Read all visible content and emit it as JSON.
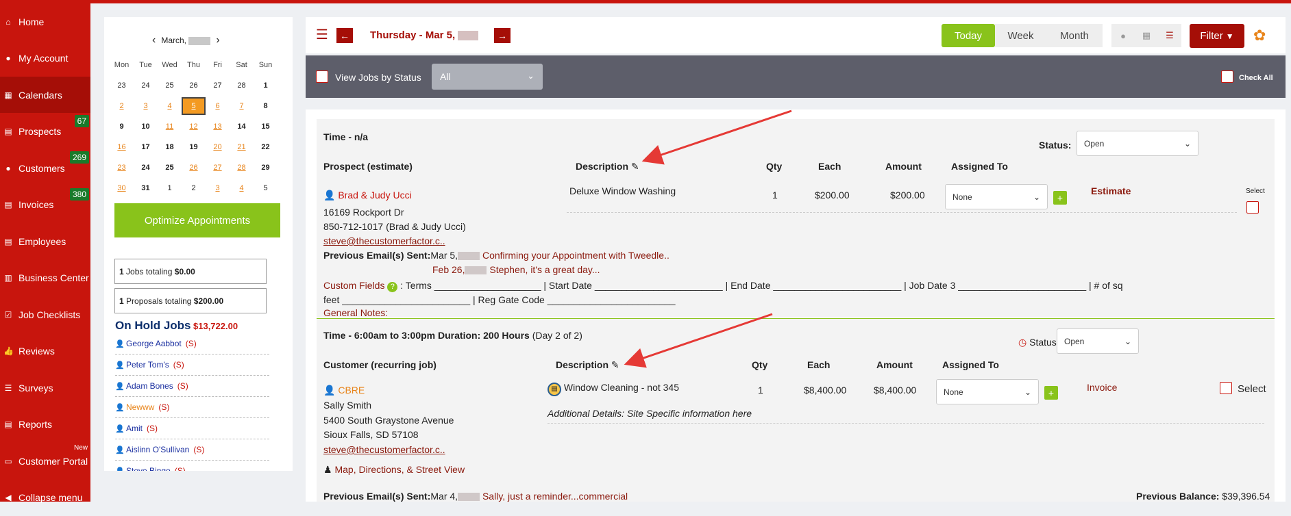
{
  "sidebar": {
    "items": [
      {
        "label": "Home",
        "icon": "home-icon",
        "glyph": "⌂"
      },
      {
        "label": "My Account",
        "icon": "user-circle-icon",
        "glyph": "●"
      },
      {
        "label": "Calendars",
        "icon": "calendar-icon",
        "glyph": "▦"
      },
      {
        "label": "Prospects",
        "icon": "document-icon",
        "glyph": "▤",
        "badge": "67"
      },
      {
        "label": "Customers",
        "icon": "users-icon",
        "glyph": "●",
        "badge": "269"
      },
      {
        "label": "Invoices",
        "icon": "invoice-icon",
        "glyph": "▤",
        "badge": "380"
      },
      {
        "label": "Employees",
        "icon": "employee-icon",
        "glyph": "▤"
      },
      {
        "label": "Business Center",
        "icon": "building-icon",
        "glyph": "▥"
      },
      {
        "label": "Job Checklists",
        "icon": "checkbox-icon",
        "glyph": "☑"
      },
      {
        "label": "Reviews",
        "icon": "thumbs-up-icon",
        "glyph": "👍"
      },
      {
        "label": "Surveys",
        "icon": "list-icon",
        "glyph": "☰"
      },
      {
        "label": "Reports",
        "icon": "report-icon",
        "glyph": "▤"
      },
      {
        "label": "Customer Portal",
        "icon": "laptop-icon",
        "glyph": "▭",
        "new_badge": "New"
      },
      {
        "label": "Collapse menu",
        "icon": "collapse-icon",
        "glyph": "◀"
      }
    ]
  },
  "calendar": {
    "month_label": "March,",
    "prev": "‹",
    "next": "›",
    "weekdays": [
      "Mon",
      "Tue",
      "Wed",
      "Thu",
      "Fri",
      "Sat",
      "Sun"
    ],
    "weeks": [
      [
        {
          "d": "23"
        },
        {
          "d": "24"
        },
        {
          "d": "25"
        },
        {
          "d": "26"
        },
        {
          "d": "27"
        },
        {
          "d": "28"
        },
        {
          "d": "1",
          "s": "bd"
        }
      ],
      [
        {
          "d": "2",
          "s": "ln"
        },
        {
          "d": "3",
          "s": "ln"
        },
        {
          "d": "4",
          "s": "ln"
        },
        {
          "d": "5",
          "s": "today"
        },
        {
          "d": "6",
          "s": "ln"
        },
        {
          "d": "7",
          "s": "ln"
        },
        {
          "d": "8",
          "s": "bd"
        }
      ],
      [
        {
          "d": "9",
          "s": "bd"
        },
        {
          "d": "10",
          "s": "bd"
        },
        {
          "d": "11",
          "s": "ln"
        },
        {
          "d": "12",
          "s": "ln"
        },
        {
          "d": "13",
          "s": "ln"
        },
        {
          "d": "14",
          "s": "bd"
        },
        {
          "d": "15",
          "s": "bd"
        }
      ],
      [
        {
          "d": "16",
          "s": "ln"
        },
        {
          "d": "17",
          "s": "bd"
        },
        {
          "d": "18",
          "s": "bd"
        },
        {
          "d": "19",
          "s": "bd"
        },
        {
          "d": "20",
          "s": "ln"
        },
        {
          "d": "21",
          "s": "ln"
        },
        {
          "d": "22",
          "s": "bd"
        }
      ],
      [
        {
          "d": "23",
          "s": "ln"
        },
        {
          "d": "24",
          "s": "bd"
        },
        {
          "d": "25",
          "s": "bd"
        },
        {
          "d": "26",
          "s": "ln"
        },
        {
          "d": "27",
          "s": "ln"
        },
        {
          "d": "28",
          "s": "ln"
        },
        {
          "d": "29",
          "s": "bd"
        }
      ],
      [
        {
          "d": "30",
          "s": "ln"
        },
        {
          "d": "31",
          "s": "bd"
        },
        {
          "d": "1"
        },
        {
          "d": "2"
        },
        {
          "d": "3",
          "s": "ln"
        },
        {
          "d": "4",
          "s": "ln"
        },
        {
          "d": "5"
        }
      ]
    ],
    "optimize_label": "Optimize Appointments",
    "jobs_count": "1",
    "jobs_text": "Jobs totaling",
    "jobs_amount": "$0.00",
    "proposals_count": "1",
    "proposals_text": "Proposals totaling",
    "proposals_amount": "$200.00"
  },
  "onhold": {
    "title": "On Hold Jobs",
    "amount": "$13,722.00",
    "items": [
      {
        "name": "George Aabbot",
        "status": "(S)",
        "orange": false
      },
      {
        "name": "Peter Tom's",
        "status": "(S)",
        "orange": false
      },
      {
        "name": "Adam Bones",
        "status": "(S)",
        "orange": false
      },
      {
        "name": "Newww",
        "status": "(S)",
        "orange": true
      },
      {
        "name": "Amit",
        "status": "(S)",
        "orange": false
      },
      {
        "name": "Aislinn O'Sullivan",
        "status": "(S)",
        "orange": false
      },
      {
        "name": "Steve Bingo",
        "status": "(S)",
        "orange": false
      }
    ]
  },
  "toolbar": {
    "date": "Thursday - Mar 5,",
    "prev": "←",
    "next": "→",
    "today": "Today",
    "week": "Week",
    "month": "Month",
    "filter": "Filter",
    "filter_icon": "▼",
    "gear": "✿"
  },
  "statusbar": {
    "label": "View Jobs by Status",
    "select_value": "All",
    "check_all": "Check All"
  },
  "job1": {
    "time": "Time - n/a",
    "status_label": "Status:",
    "status_value": "Open",
    "type": "Prospect (estimate)",
    "hdr_description": "Description",
    "hdr_qty": "Qty",
    "hdr_each": "Each",
    "hdr_amount": "Amount",
    "hdr_assigned": "Assigned To",
    "name": "Brad & Judy Ucci",
    "address": "16169 Rockport Dr",
    "phone": "850-712-1017 (Brad & Judy Ucci)",
    "email": "steve@thecustomerfactor.c..",
    "description": "Deluxe Window Washing",
    "qty": "1",
    "each": "$200.00",
    "amount": "$200.00",
    "assigned": "None",
    "action": "Estimate",
    "select_label": "Select",
    "prev_email_label": "Previous Email(s) Sent:",
    "email1_date": "Mar 5,",
    "email1_subject": "Confirming your Appointment with Tweedle..",
    "email2_date": "Feb 26,",
    "email2_subject": "Stephen, it's a great day...",
    "custom_fields": "Custom Fields",
    "custom_text_1": ": Terms ____________________ | Start Date ________________________ | End Date ________________________ | Job Date 3 ________________________ | # of sq",
    "custom_text_2": "feet ________________________ | Reg Gate Code ________________________",
    "general_notes": "General Notes:"
  },
  "job2": {
    "time": "Time - 6:00am to 3:00pm Duration: 200 Hours",
    "day": "(Day 2 of 2)",
    "status_label": "Status:",
    "status_value": "Open",
    "type": "Customer (recurring job)",
    "hdr_description": "Description",
    "hdr_qty": "Qty",
    "hdr_each": "Each",
    "hdr_amount": "Amount",
    "hdr_assigned": "Assigned To",
    "name": "CBRE",
    "contact": "Sally Smith",
    "address": "5400 South Graystone Avenue",
    "city": "Sioux Falls, SD 57108",
    "email": "steve@thecustomerfactor.c..",
    "description": "Window Cleaning - not 345",
    "qty": "1",
    "each": "$8,400.00",
    "amount": "$8,400.00",
    "assigned": "None",
    "action": "Invoice",
    "select_label": "Select",
    "additional": "Additional Details: Site Specific information here",
    "map": "Map, Directions, & Street View",
    "prev_email_label": "Previous Email(s) Sent:",
    "email1_date": "Mar 4,",
    "email1_subject": "Sally, just a reminder...commercial",
    "prev_balance_label": "Previous Balance:",
    "prev_balance": "$39,396.54"
  },
  "colors": {
    "brand_red": "#c8150d",
    "dark_red": "#a50e07",
    "accent_green": "#89c31b",
    "orange": "#f39a22",
    "arrow": "#e53935"
  }
}
